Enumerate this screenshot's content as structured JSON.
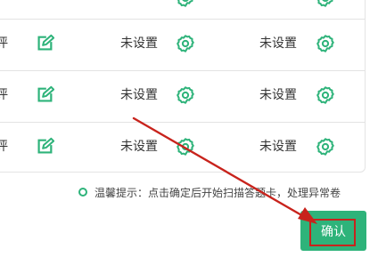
{
  "table": {
    "rows": [
      {
        "label": "评",
        "col1": "未设置",
        "col2": "未设置"
      },
      {
        "label": "评",
        "col1": "未设置",
        "col2": "未设置"
      },
      {
        "label": "评",
        "col1": "未设置",
        "col2": "未设置"
      }
    ]
  },
  "tip": {
    "text": "温馨提示：点击确定后开始扫描答题卡，处理异常卷"
  },
  "confirm": {
    "label": "确认"
  },
  "icons": {
    "edit": "edit-icon",
    "settings": "gear-icon",
    "tip": "circle-icon"
  },
  "colors": {
    "accent": "#2eb37a",
    "annotation": "#c8231c"
  }
}
